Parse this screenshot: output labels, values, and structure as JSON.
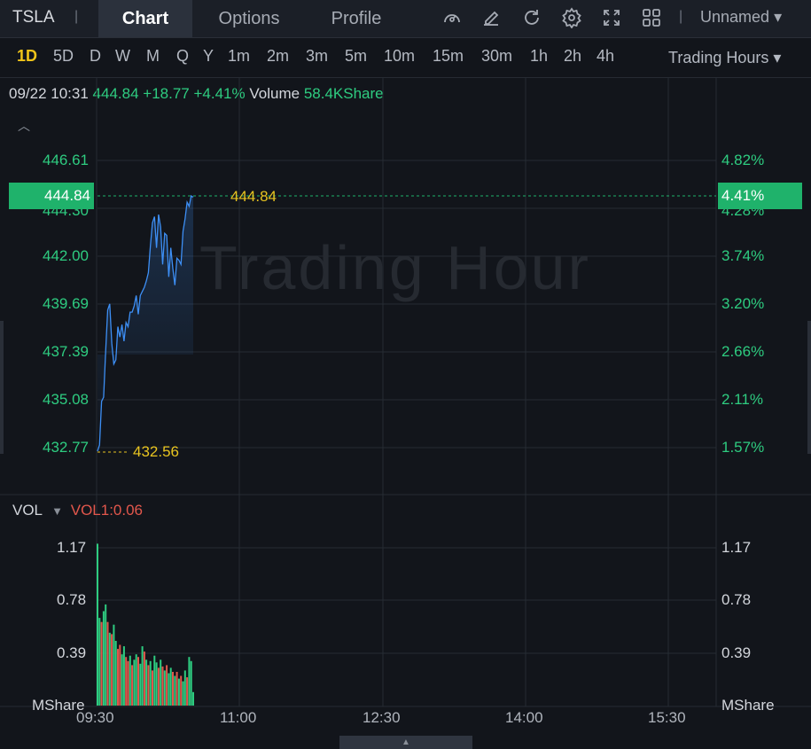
{
  "header": {
    "ticker": "TSLA",
    "tabs": [
      {
        "label": "Chart",
        "active": true
      },
      {
        "label": "Options",
        "active": false
      },
      {
        "label": "Profile",
        "active": false
      }
    ],
    "icons": [
      "gauge-icon",
      "draw-pen-icon",
      "refresh-icon",
      "gear-icon",
      "fullscreen-icon",
      "layout-grid-icon"
    ],
    "layout_name": "Unnamed"
  },
  "periods": {
    "items": [
      "1D",
      "5D",
      "D",
      "W",
      "M",
      "Q",
      "Y",
      "1m",
      "2m",
      "3m",
      "5m",
      "10m",
      "15m",
      "30m",
      "1h",
      "2h",
      "4h"
    ],
    "active": "1D",
    "session_label": "Trading Hours"
  },
  "quote": {
    "datetime": "09/22 10:31",
    "price": "444.84",
    "change": "+18.77",
    "change_pct": "+4.41%",
    "volume_label": "Volume",
    "volume": "58.4KShare"
  },
  "price_axis": {
    "left_ticks": [
      "446.61",
      "442.00",
      "439.69",
      "437.39",
      "435.08",
      "432.77"
    ],
    "hidden_tick": "444.30",
    "right_ticks": [
      "4.82%",
      "3.74%",
      "3.20%",
      "2.66%",
      "2.11%",
      "1.57%"
    ],
    "hidden_right_tick": "4.28%",
    "current_badge_left": "444.84",
    "current_badge_right": "4.41%",
    "current_line_label": "444.84",
    "low_label": "432.56"
  },
  "watermark": "Trading Hour",
  "volume_panel": {
    "title": "VOL",
    "indicator": "VOL1:0.06",
    "ticks_left": [
      "1.17",
      "0.78",
      "0.39"
    ],
    "ticks_right": [
      "1.17",
      "0.78",
      "0.39"
    ],
    "unit": "MShare"
  },
  "time_axis": [
    "09:30",
    "11:00",
    "12:30",
    "14:00",
    "15:30"
  ],
  "colors": {
    "up": "#2ecc80",
    "down": "#e2574c",
    "line": "#3d8ff5",
    "accent": "#f0c419"
  },
  "chart_data": {
    "type": "line",
    "title": "",
    "x_start": "09:30",
    "interval": "1m",
    "price_series": [
      432.6,
      432.9,
      435.0,
      435.2,
      437.4,
      439.4,
      439.7,
      437.8,
      436.8,
      437.0,
      438.6,
      438.1,
      438.7,
      437.9,
      438.8,
      438.6,
      439.3,
      439.3,
      439.6,
      440.1,
      439.2,
      440.1,
      440.3,
      440.5,
      440.8,
      441.2,
      442.5,
      443.6,
      443.9,
      442.4,
      444.0,
      443.4,
      441.6,
      443.1,
      443.0,
      441.0,
      442.4,
      441.4,
      440.6,
      441.9,
      441.8,
      441.6,
      443.2,
      443.8,
      444.6,
      444.4,
      444.9,
      444.84
    ],
    "volume_mshare": [
      1.2,
      0.65,
      0.62,
      0.7,
      0.75,
      0.62,
      0.54,
      0.53,
      0.6,
      0.48,
      0.42,
      0.45,
      0.38,
      0.44,
      0.36,
      0.33,
      0.37,
      0.3,
      0.34,
      0.38,
      0.36,
      0.31,
      0.44,
      0.4,
      0.34,
      0.3,
      0.33,
      0.26,
      0.37,
      0.32,
      0.28,
      0.34,
      0.29,
      0.26,
      0.3,
      0.24,
      0.28,
      0.25,
      0.22,
      0.25,
      0.2,
      0.22,
      0.18,
      0.26,
      0.21,
      0.36,
      0.33,
      0.1
    ],
    "volume_up": [
      1,
      1,
      0,
      1,
      1,
      0,
      1,
      0,
      1,
      1,
      0,
      0,
      1,
      1,
      0,
      0,
      1,
      0,
      1,
      1,
      0,
      1,
      1,
      0,
      1,
      0,
      1,
      0,
      1,
      1,
      0,
      1,
      0,
      1,
      0,
      1,
      1,
      0,
      1,
      0,
      1,
      0,
      1,
      1,
      0,
      1,
      1,
      1
    ],
    "price_ylim": [
      432.0,
      447.5
    ],
    "volume_ylim": [
      0,
      1.3
    ]
  }
}
